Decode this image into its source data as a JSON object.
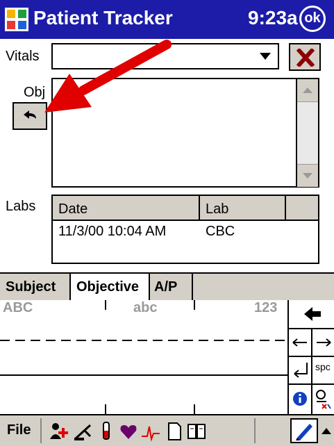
{
  "titlebar": {
    "title": "Patient Tracker",
    "time": "9:23a",
    "ok_label": "ok"
  },
  "vitals": {
    "label": "Vitals",
    "value": ""
  },
  "obj": {
    "label": "Obj",
    "text": ""
  },
  "labs": {
    "label": "Labs",
    "columns": [
      "Date",
      "Lab"
    ],
    "rows": [
      {
        "date": "11/3/00 10:04 AM",
        "lab": "CBC"
      }
    ]
  },
  "tabs": [
    {
      "label": "Subject",
      "active": false
    },
    {
      "label": "Objective",
      "active": true
    },
    {
      "label": "A/P",
      "active": false
    }
  ],
  "input_panel": {
    "ruler_left": "ABC",
    "ruler_mid": "abc",
    "ruler_right": "123",
    "space_label": "spc"
  },
  "toolbar": {
    "file_label": "File"
  },
  "colors": {
    "title_bg": "#1c1ca8",
    "chrome": "#d4d0c8",
    "arrow": "#e00000"
  }
}
